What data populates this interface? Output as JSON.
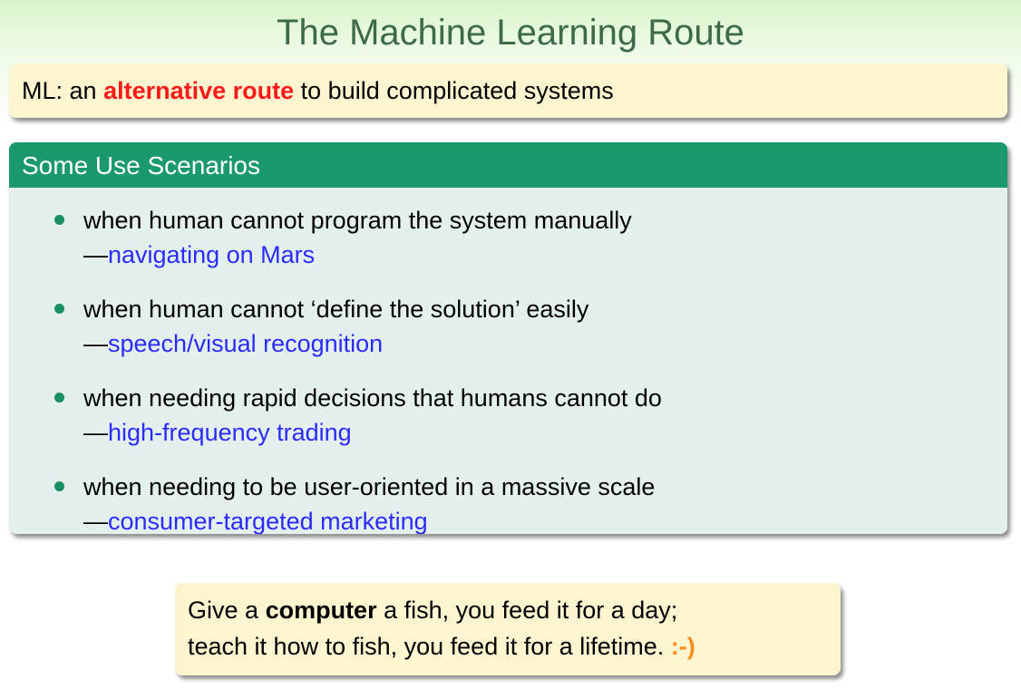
{
  "title": "The Machine Learning Route",
  "ml_box": {
    "prefix": "ML: an",
    "highlight": "alternative route",
    "suffix": "to build complicated systems"
  },
  "scenarios": {
    "header": "Some Use Scenarios",
    "items": [
      {
        "text": "when human cannot program the system manually",
        "dash": "—",
        "example": "navigating on Mars"
      },
      {
        "text": "when human cannot ‘define the solution’ easily",
        "dash": "—",
        "example": "speech/visual recognition"
      },
      {
        "text": "when needing rapid decisions that humans cannot do",
        "dash": "—",
        "example": "high-frequency trading"
      },
      {
        "text": "when needing to be user-oriented in a massive scale",
        "dash": "—",
        "example": "consumer-targeted marketing"
      }
    ]
  },
  "quote": {
    "line1_prefix": "Give a",
    "line1_bold": "computer",
    "line1_suffix": "a fish, you feed it for a day;",
    "line2": "teach it how to fish, you feed it for a lifetime.",
    "smiley": ":-)"
  },
  "colors": {
    "title": "#3d6b4a",
    "alert": "#ff1a1a",
    "block_header": "#1a9a6a",
    "block_body": "#e3f0ee",
    "example_link": "#2b2bff",
    "smiley": "#ff8c1a",
    "callout_background": "#fdf5d0"
  }
}
